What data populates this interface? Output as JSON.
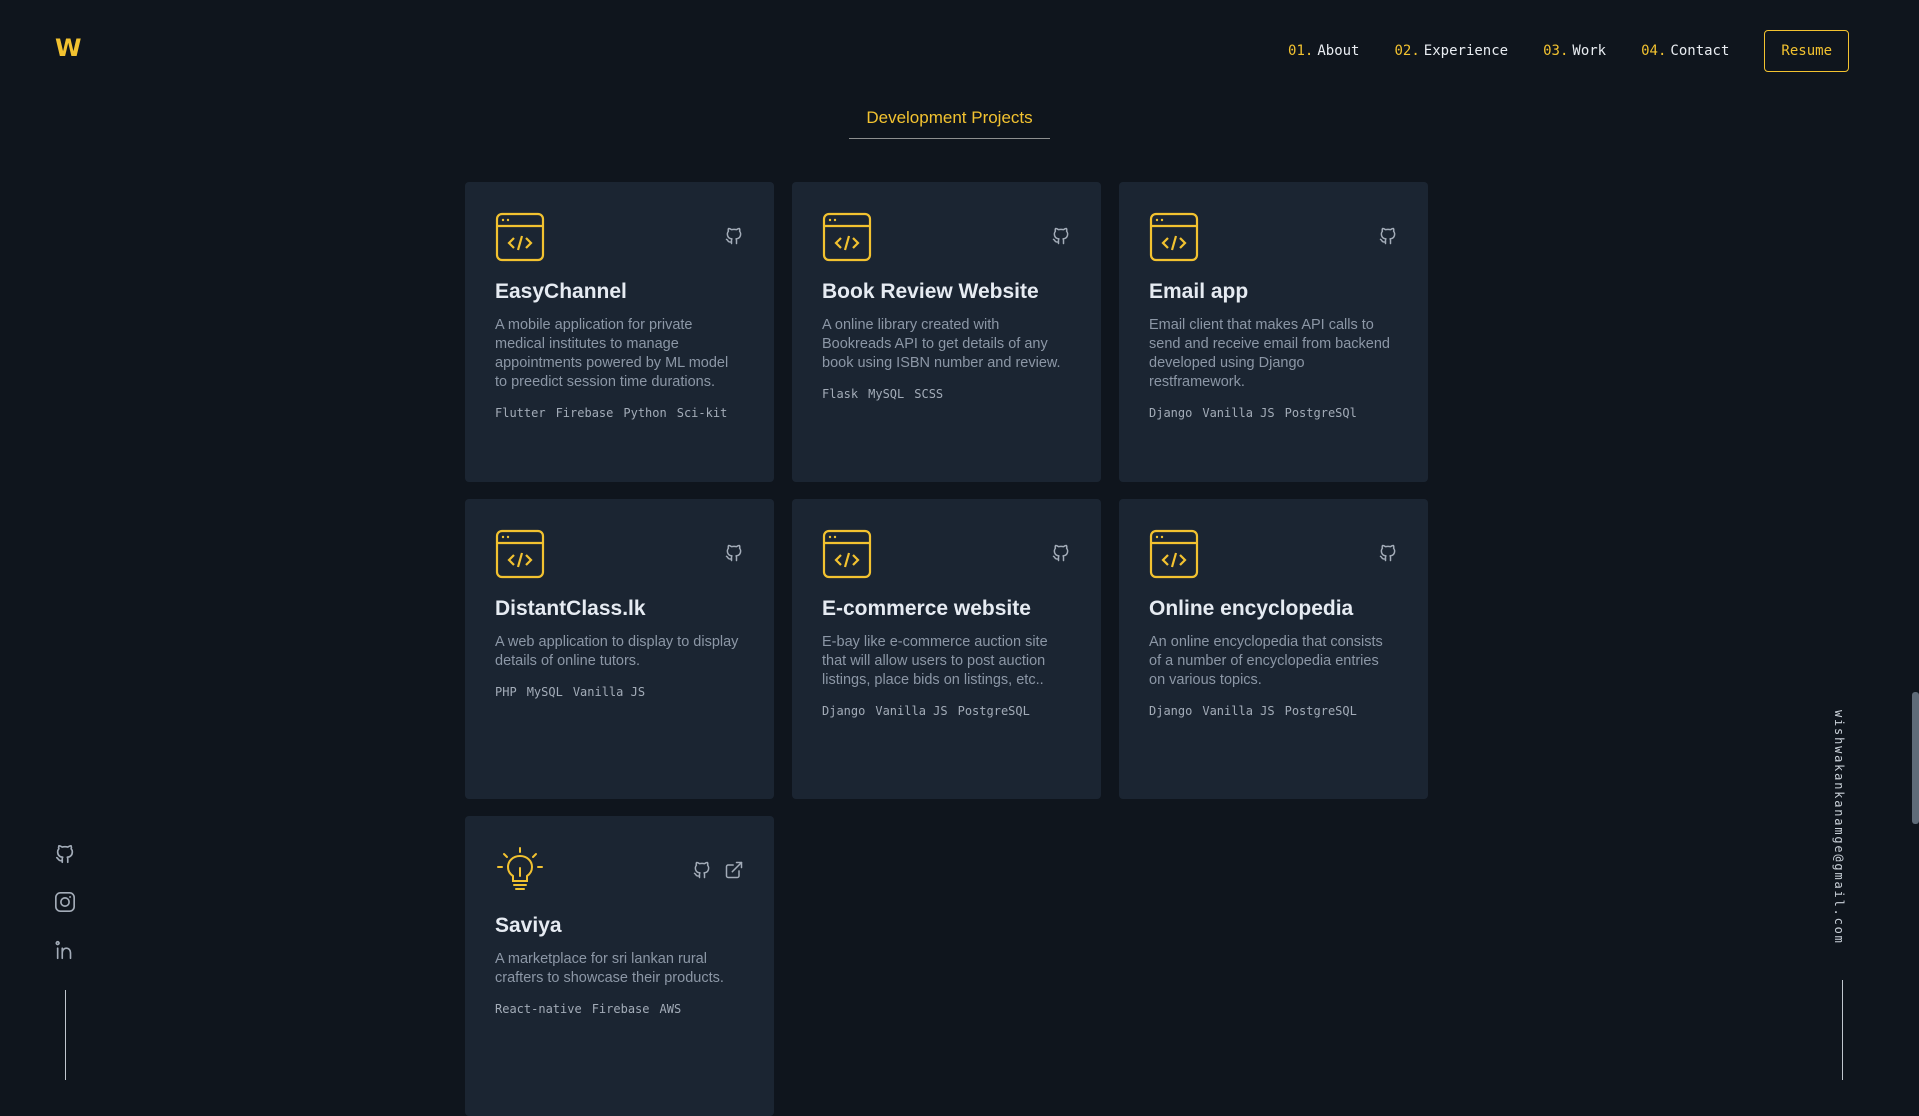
{
  "logo": "W",
  "nav": [
    {
      "num": "01.",
      "label": "About"
    },
    {
      "num": "02.",
      "label": "Experience"
    },
    {
      "num": "03.",
      "label": "Work"
    },
    {
      "num": "04.",
      "label": "Contact"
    }
  ],
  "resume_label": "Resume",
  "section_title": "Development Projects",
  "projects": [
    {
      "title": "EasyChannel",
      "desc": "A mobile application for private medical institutes to manage appointments powered by ML model to preedict session time durations.",
      "tech": [
        "Flutter",
        "Firebase",
        "Python",
        "Sci-kit"
      ]
    },
    {
      "title": "Book Review Website",
      "desc": "A online library created with Bookreads API to get details of any book using ISBN number and review.",
      "tech": [
        "Flask",
        "MySQL",
        "SCSS"
      ]
    },
    {
      "title": "Email app",
      "desc": "Email client that makes API calls to send and receive email from backend developed using Django restframework.",
      "tech": [
        "Django",
        "Vanilla JS",
        "PostgreSQl"
      ]
    },
    {
      "title": "DistantClass.lk",
      "desc": "A web application to display to display details of online tutors.",
      "tech": [
        "PHP",
        "MySQL",
        "Vanilla JS"
      ]
    },
    {
      "title": "E-commerce website",
      "desc": "E-bay like e-commerce auction site that will allow users to post auction listings, place bids on listings, etc..",
      "tech": [
        "Django",
        "Vanilla JS",
        "PostgreSQL"
      ]
    },
    {
      "title": "Online encyclopedia",
      "desc": "An online encyclopedia that consists of a number of encyclopedia entries on various topics.",
      "tech": [
        "Django",
        "Vanilla JS",
        "PostgreSQL"
      ]
    },
    {
      "title": "Saviya",
      "desc": "A marketplace for sri lankan rural crafters to showcase their products.",
      "tech": [
        "React-native",
        "Firebase",
        "AWS"
      ]
    }
  ],
  "email": "wishwakankanamge@gmail.com",
  "colors": {
    "accent": "#f2c230",
    "background": "#0f151d",
    "card": "#1b2532"
  }
}
